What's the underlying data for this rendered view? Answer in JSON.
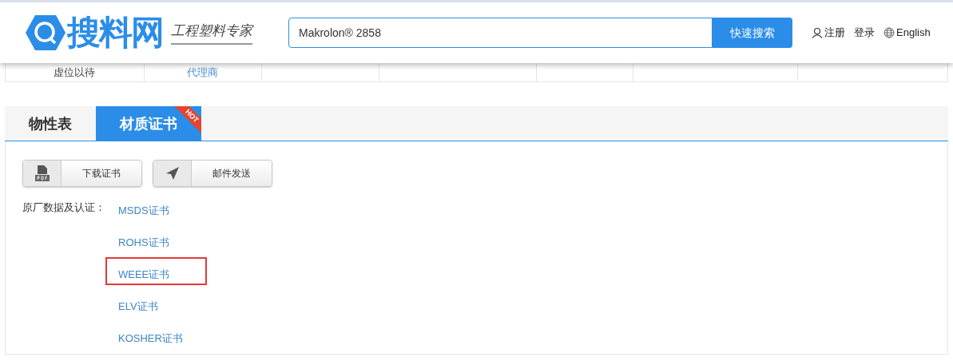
{
  "header": {
    "logo_text": "搜料网",
    "slogan": "工程塑料专家",
    "search": {
      "value": "Makrolon® 2858",
      "button": "快速搜索"
    },
    "links": [
      {
        "kind": "user",
        "label": "注册"
      },
      {
        "kind": "plain",
        "label": "登录"
      },
      {
        "kind": "globe",
        "label": "English"
      }
    ]
  },
  "partial_row": {
    "cells": [
      {
        "text": "虚位以待",
        "kind": "text"
      },
      {
        "text": "代理商",
        "kind": "link"
      }
    ]
  },
  "tabs": [
    {
      "label": "物性表",
      "selected": false,
      "hot": false
    },
    {
      "label": "材质证书",
      "selected": true,
      "hot": true,
      "badge": "HOT"
    }
  ],
  "actions": [
    {
      "kind": "pdf",
      "label": "下载证书"
    },
    {
      "kind": "send",
      "label": "邮件发送"
    }
  ],
  "certificates": {
    "label": "原厂数据及认证：",
    "links": [
      {
        "label": "MSDS证书",
        "highlighted": false
      },
      {
        "label": "ROHS证书",
        "highlighted": false
      },
      {
        "label": "WEEE证书",
        "highlighted": true
      },
      {
        "label": "ELV证书",
        "highlighted": false
      },
      {
        "label": "KOSHER证书",
        "highlighted": false
      }
    ]
  }
}
